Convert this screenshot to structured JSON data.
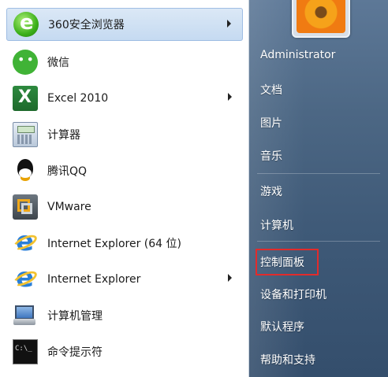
{
  "programs": [
    {
      "label": "360安全浏览器",
      "icon": "360-browser-icon",
      "has_submenu": true
    },
    {
      "label": "微信",
      "icon": "wechat-icon",
      "has_submenu": false
    },
    {
      "label": "Excel 2010",
      "icon": "excel-icon",
      "has_submenu": true
    },
    {
      "label": "计算器",
      "icon": "calculator-icon",
      "has_submenu": false
    },
    {
      "label": "腾讯QQ",
      "icon": "qq-icon",
      "has_submenu": false
    },
    {
      "label": "VMware",
      "icon": "vmware-icon",
      "has_submenu": false
    },
    {
      "label": "Internet Explorer (64 位)",
      "icon": "internet-explorer-icon",
      "has_submenu": false
    },
    {
      "label": "Internet Explorer",
      "icon": "internet-explorer-icon",
      "has_submenu": true
    },
    {
      "label": "计算机管理",
      "icon": "computer-management-icon",
      "has_submenu": false
    },
    {
      "label": "命令提示符",
      "icon": "command-prompt-icon",
      "has_submenu": false
    }
  ],
  "user": {
    "name": "Administrator",
    "avatar_icon": "user-picture-flower-icon"
  },
  "right_menu": [
    "文档",
    "图片",
    "音乐",
    "游戏",
    "计算机",
    "控制面板",
    "设备和打印机",
    "默认程序",
    "帮助和支持"
  ],
  "highlighted_item": "控制面板",
  "colors": {
    "highlight_box": "#e22b2b",
    "right_pane": "#4c6784",
    "hover": "#c5daf1"
  }
}
